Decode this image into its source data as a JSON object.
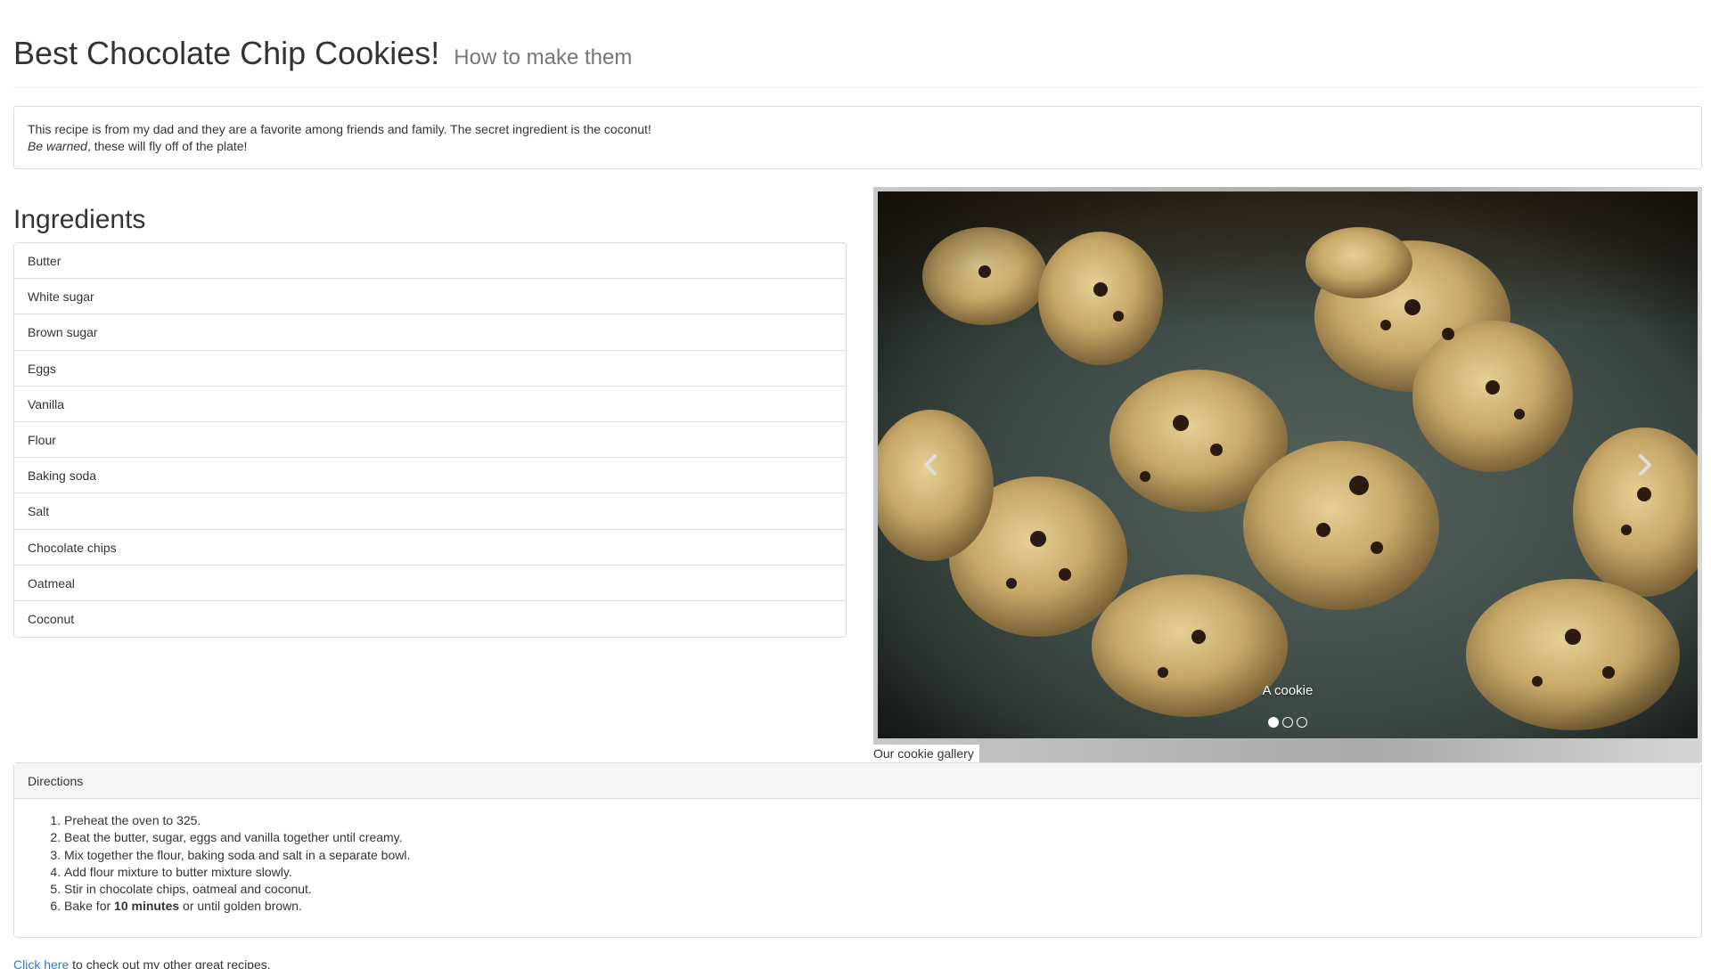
{
  "header": {
    "title": "Best Chocolate Chip Cookies!",
    "subtitle": "How to make them"
  },
  "intro": {
    "line1": "This recipe is from my dad and they are a favorite among friends and family. The secret ingredient is the coconut!",
    "warning_em": "Be warned",
    "warning_rest": ", these will fly off of the plate!"
  },
  "ingredients": {
    "title": "Ingredients",
    "items": [
      "Butter",
      "White sugar",
      "Brown sugar",
      "Eggs",
      "Vanilla",
      "Flour",
      "Baking soda",
      "Salt",
      "Chocolate chips",
      "Oatmeal",
      "Coconut"
    ]
  },
  "gallery": {
    "caption": "A cookie",
    "label": "Our cookie gallery",
    "slide_count": 3,
    "active_slide": 1,
    "prev_icon": "chevron-left-icon",
    "next_icon": "chevron-right-icon"
  },
  "directions": {
    "heading": "Directions",
    "steps": [
      "Preheat the oven to 325.",
      "Beat the butter, sugar, eggs and vanilla together until creamy.",
      "Mix together the flour, baking soda and salt in a separate bowl.",
      "Add flour mixture to butter mixture slowly.",
      "Stir in chocolate chips, oatmeal and coconut."
    ],
    "last_step": {
      "before": "Bake for ",
      "bold": "10 minutes",
      "after": " or until golden brown."
    }
  },
  "footer": {
    "link_text": "Click here",
    "rest": " to check out my other great recipes."
  },
  "colors": {
    "link": "#337ab7",
    "border": "#dddddd",
    "panel_heading_bg": "#f5f5f5",
    "muted": "#777777"
  }
}
